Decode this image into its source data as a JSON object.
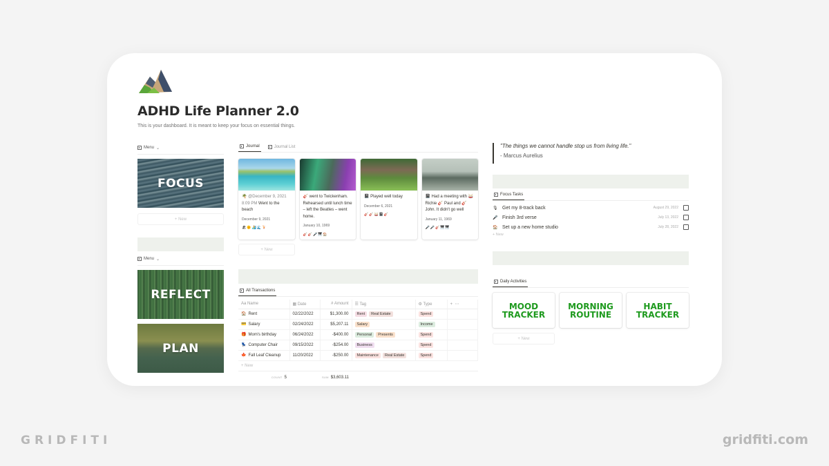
{
  "page": {
    "icon": "mountain-icon",
    "title": "ADHD Life Planner 2.0",
    "description": "This is your dashboard. It is meant to keep your focus on essential things."
  },
  "left": {
    "menu1_label": "Menu",
    "menu2_label": "Menu",
    "tiles": [
      "FOCUS",
      "REFLECT",
      "PLAN"
    ],
    "new_label": "+ New"
  },
  "journal": {
    "tabs": [
      "Journal",
      "Journal List"
    ],
    "cards": [
      {
        "emoji": "🌴",
        "meta": "@December 9, 2021 8:09 PM",
        "text": "Went to the beach",
        "date": "December 9, 2021",
        "tags": "🏖🌞🏄🌊🍹"
      },
      {
        "emoji": "🎸",
        "meta": "",
        "text": "went to Twickenham. Rehearsed until lunch time – left the Beatles – went home.",
        "date": "January 10, 1969",
        "tags": "🎸🎸🎤🎹🏠"
      },
      {
        "emoji": "📓",
        "meta": "",
        "text": "Played well today",
        "date": "December 6, 2021",
        "tags": "🎸🎸🥁📓🎸"
      },
      {
        "emoji": "📓",
        "meta": "",
        "text": "Had a meeting with 🥁 Richie 🎸 Paul and 🎸 John. It didn't go well",
        "date": "January 11, 1969",
        "tags": "🎤🎤🎸🎹🎹"
      }
    ],
    "new_label": "+ New"
  },
  "transactions": {
    "tab": "All Transactions",
    "columns": [
      "Name",
      "Date",
      "Amount",
      "Tag",
      "Type"
    ],
    "rows": [
      {
        "emoji": "🏠",
        "name": "Rent",
        "date": "02/22/2022",
        "amount": "$1,300.00",
        "tags": [
          {
            "label": "Rent",
            "bg": "#f5dde4"
          },
          {
            "label": "Real Estate",
            "bg": "#f2e0dd"
          }
        ],
        "type": "Spend",
        "type_bg": "#fbe2e0"
      },
      {
        "emoji": "💳",
        "name": "Salary",
        "date": "02/24/2022",
        "amount": "$5,207.11",
        "tags": [
          {
            "label": "Salary",
            "bg": "#fae1cc"
          }
        ],
        "type": "Income",
        "type_bg": "#dcecdf"
      },
      {
        "emoji": "🎁",
        "name": "Mom's birthday",
        "date": "06/24/2022",
        "amount": "-$400.00",
        "tags": [
          {
            "label": "Personal",
            "bg": "#dcecdf"
          },
          {
            "label": "Presents",
            "bg": "#fae1cc"
          }
        ],
        "type": "Spend",
        "type_bg": "#fbe2e0"
      },
      {
        "emoji": "💺",
        "name": "Computer Chair",
        "date": "09/15/2022",
        "amount": "-$254.00",
        "tags": [
          {
            "label": "Business",
            "bg": "#f0def0"
          }
        ],
        "type": "Spend",
        "type_bg": "#fbe2e0"
      },
      {
        "emoji": "🍁",
        "name": "Fall Leaf Cleanup",
        "date": "11/20/2022",
        "amount": "-$250.00",
        "tags": [
          {
            "label": "Maintenance",
            "bg": "#fbe2e0"
          },
          {
            "label": "Real Estate",
            "bg": "#f2e0dd"
          }
        ],
        "type": "Spend",
        "type_bg": "#fbe2e0"
      }
    ],
    "new_label": "+ New",
    "count_label": "COUNT",
    "count": "5",
    "sum_label": "SUM",
    "sum": "$3,603.11"
  },
  "quote": {
    "text": "\"The things we cannot handle stop us from living life.\"",
    "author": "- Marcus Aurelius"
  },
  "focus_tasks": {
    "tab": "Focus Tasks",
    "items": [
      {
        "emoji": "🎙",
        "name": "Get my 8-track back",
        "date": "August 29, 2022",
        "done": false
      },
      {
        "emoji": "🎤",
        "name": "Finish 3rd verse",
        "date": "July 13, 2022",
        "done": false
      },
      {
        "emoji": "🏠",
        "name": "Set up a new home studio",
        "date": "July 28, 2022",
        "done": false
      }
    ],
    "new_label": "+ New"
  },
  "daily": {
    "tab": "Daily Activities",
    "items": [
      "MOOD\nTRACKER",
      "MORNING\nROUTINE",
      "HABIT\nTRACKER"
    ],
    "new_label": "+ New",
    "accent": "#1e9a1e"
  },
  "branding": {
    "left": "GRIDFITI",
    "right": "gridfiti.com"
  }
}
